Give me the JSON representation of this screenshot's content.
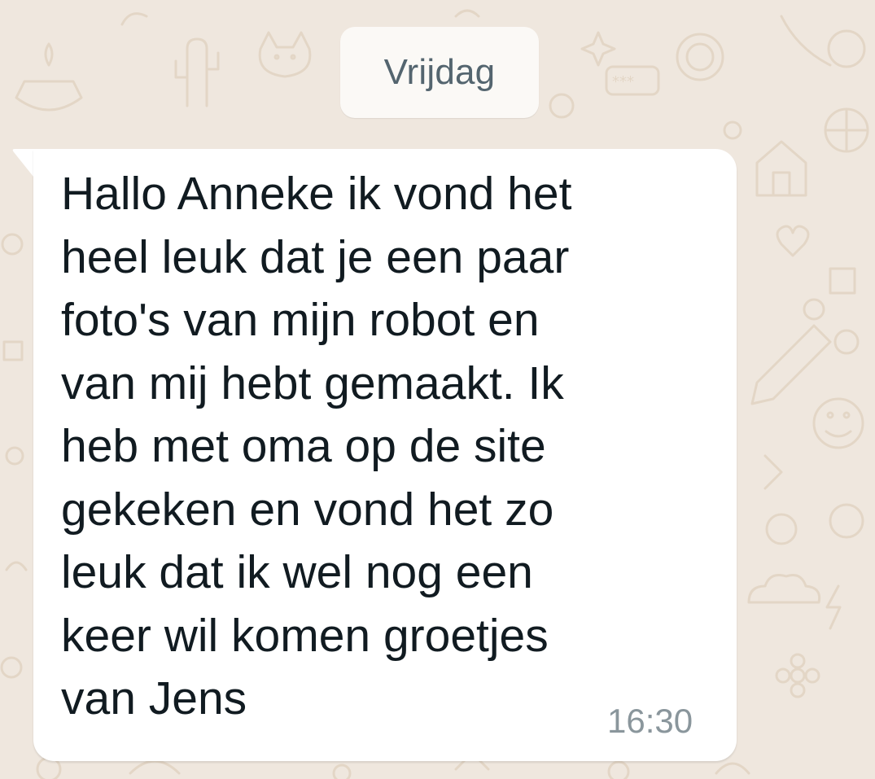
{
  "chat": {
    "date_separator": "Vrijdag",
    "message": {
      "lines": [
        "Hallo Anneke ik vond het",
        "heel leuk dat je een paar",
        "foto's van mijn robot en",
        "van mij hebt gemaakt. Ik",
        "heb met oma op de site",
        "gekeken en vond het zo",
        "leuk dat ik wel nog een",
        "keer wil komen groetjes",
        "van Jens"
      ],
      "time": "16:30",
      "direction": "incoming"
    }
  },
  "theme": {
    "wallpaper_color": "#efe7de",
    "doodle_color": "#e3d6c6",
    "bubble_color": "#ffffff",
    "text_color": "#111b21",
    "time_color": "#8a969c",
    "chip_text_color": "#54656f"
  },
  "icons": [
    "doodle-wallpaper-pattern"
  ]
}
